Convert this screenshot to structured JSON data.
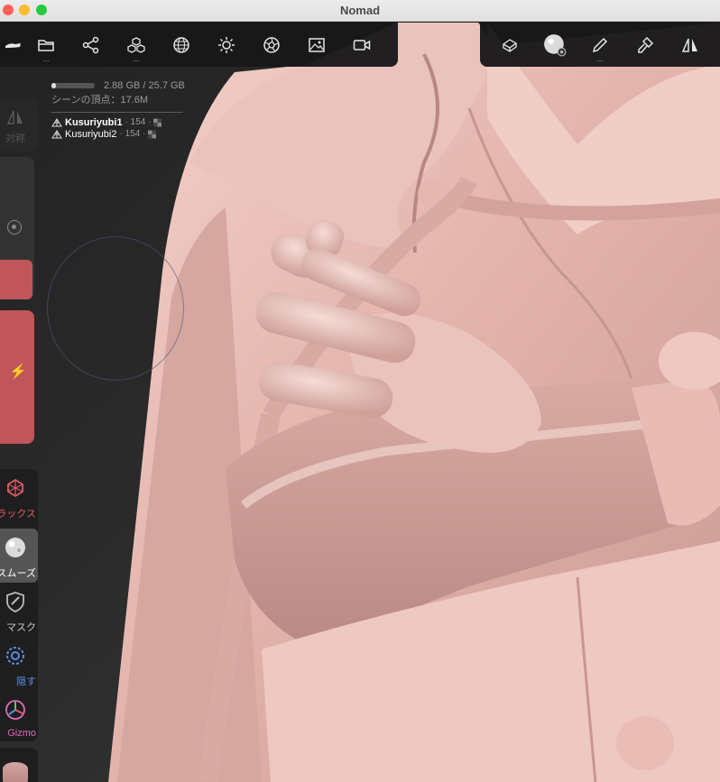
{
  "window": {
    "title": "Nomad"
  },
  "toolbar_left": {
    "buttons": [
      {
        "icon": "nomad-logo-icon",
        "dots": ""
      },
      {
        "icon": "folder-icon",
        "dots": "..."
      },
      {
        "icon": "scene-graph-icon",
        "dots": ""
      },
      {
        "icon": "primitives-icon",
        "dots": "..."
      },
      {
        "icon": "topology-sphere-icon",
        "dots": ""
      },
      {
        "icon": "light-icon",
        "dots": ""
      },
      {
        "icon": "material-icon",
        "dots": ""
      },
      {
        "icon": "background-image-icon",
        "dots": ""
      },
      {
        "icon": "camera-icon",
        "dots": ""
      }
    ]
  },
  "toolbar_right": {
    "buttons": [
      {
        "icon": "eraser-tool-icon",
        "dots": ""
      },
      {
        "icon": "smooth-brush-settings-icon",
        "dots": ""
      },
      {
        "icon": "brush-pen-icon",
        "dots": "..."
      },
      {
        "icon": "paint-brush-icon",
        "dots": ""
      },
      {
        "icon": "symmetry-icon",
        "dots": ""
      }
    ]
  },
  "stats": {
    "memory": "2.88 GB / 25.7 GB",
    "memory_fraction": 0.11,
    "vertices": "シーンの頂点：17.6M",
    "objects": [
      {
        "name": "Kusuriyubi1",
        "meta": "· 154 ·",
        "bold": true
      },
      {
        "name": "Kusuriyubi2",
        "meta": "· 154 ·",
        "bold": false
      }
    ]
  },
  "side": {
    "symmetry_label": "対称",
    "tools": [
      {
        "label": "ラックス",
        "color": "#e05a64",
        "icon": "relax-icon"
      },
      {
        "label": "スムーズ",
        "color": "#ffffff",
        "icon": "smooth-icon"
      },
      {
        "label": "マスク",
        "color": "#c8c8c8",
        "icon": "mask-icon"
      },
      {
        "label": "隠す",
        "color": "#5b8de0",
        "icon": "hide-icon"
      },
      {
        "label": "Gizmo",
        "color": "#e06bb8",
        "icon": "gizmo-icon"
      }
    ]
  },
  "colors": {
    "accent_red": "#c0555a",
    "model": "#e7bdb6"
  }
}
